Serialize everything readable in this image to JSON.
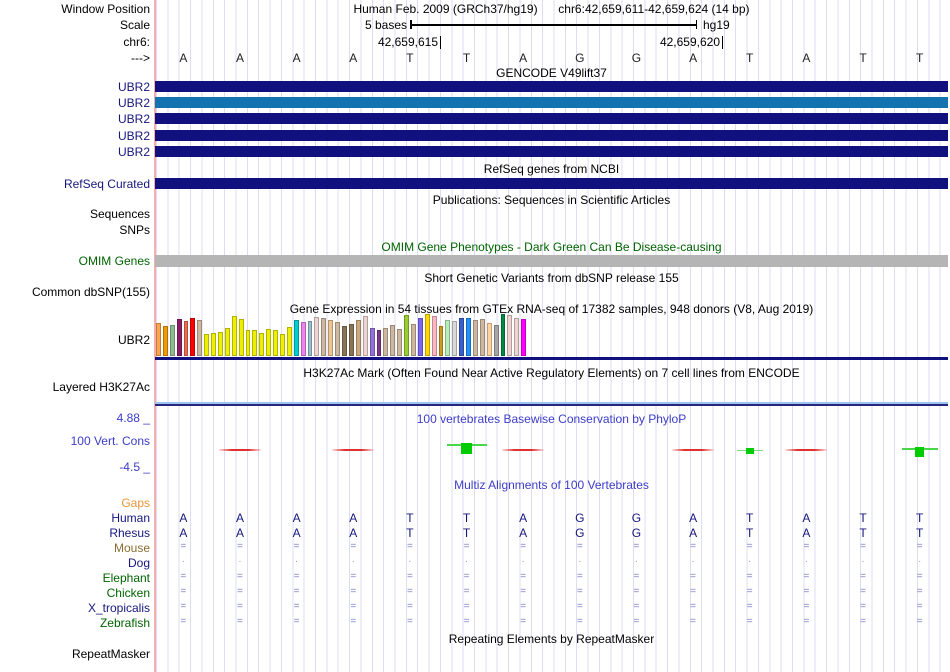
{
  "palette": {
    "navy": "#10107e",
    "steel_blue": "#1273b0",
    "gray_bar": "#b5b5b5",
    "grid_line": "#dcdcf2",
    "window_edge_pink": "#f5afaf",
    "blue_label": "#3c3cc8",
    "green_label": "#006400",
    "orange_label": "#e8953a",
    "align_symbol": "#8181c8",
    "phylop_pos": "#00cc00",
    "phylop_neg": "#e03030",
    "h3k27ac_light": "#9cc3ef",
    "h3k27ac_dark": "#26267e"
  },
  "header": {
    "window_position_label": "Window Position",
    "assembly": "Human Feb. 2009 (GRCh37/hg19)",
    "position": "chr6:42,659,611-42,659,624 (14 bp)",
    "scale_label": "Scale",
    "scale_value": "5 bases",
    "genome": "hg19",
    "chrom_label": "chr6:",
    "tick_left": "42,659,615",
    "tick_right": "42,659,620",
    "strand_arrow": "--->"
  },
  "sequence": {
    "bases": [
      "A",
      "A",
      "A",
      "A",
      "T",
      "T",
      "A",
      "G",
      "G",
      "A",
      "T",
      "A",
      "T",
      "T"
    ]
  },
  "tracks": {
    "gencode": {
      "title": "GENCODE V49lift37",
      "items": [
        {
          "label": "UBR2",
          "color": "#10107e"
        },
        {
          "label": "UBR2",
          "color": "#1273b0"
        },
        {
          "label": "UBR2",
          "color": "#10107e"
        },
        {
          "label": "UBR2",
          "color": "#10107e"
        },
        {
          "label": "UBR2",
          "color": "#10107e"
        }
      ]
    },
    "refseq": {
      "title": "RefSeq genes from NCBI",
      "item_label": "RefSeq Curated",
      "item_color": "#10107e"
    },
    "publications": {
      "title": "Publications: Sequences in Scientific Articles",
      "row_labels": [
        "Sequences",
        "SNPs"
      ]
    },
    "omim": {
      "title": "OMIM Gene Phenotypes - Dark Green Can Be Disease-causing",
      "label": "OMIM Genes",
      "bar_color": "#b5b5b5"
    },
    "dbsnp": {
      "title": "Short Genetic Variants from dbSNP release 155",
      "label": "Common dbSNP(155)"
    },
    "gtex": {
      "title": "Gene Expression in 54 tissues from GTEx RNA-seq of 17382 samples, 948 donors (V8, Aug 2019)",
      "label": "UBR2"
    },
    "h3k27ac": {
      "title": "H3K27Ac Mark (Often Found Near Active Regulatory Elements) on 7 cell lines from ENCODE",
      "label": "Layered H3K27Ac"
    },
    "phylop": {
      "title": "100 vertebrates Basewise Conservation by PhyloP",
      "label": "100 Vert. Cons",
      "scale_max": "4.88 _",
      "scale_min": "-4.5 _",
      "marks": [
        {
          "base": 2,
          "kind": "neg"
        },
        {
          "base": 4,
          "kind": "neg"
        },
        {
          "base": 6,
          "kind": "pos_large"
        },
        {
          "base": 7,
          "kind": "neg"
        },
        {
          "base": 10,
          "kind": "neg"
        },
        {
          "base": 11,
          "kind": "pos_small"
        },
        {
          "base": 12,
          "kind": "neg"
        },
        {
          "base": 14,
          "kind": "pos_medium"
        }
      ]
    },
    "multiz": {
      "title": "Multiz Alignments of 100 Vertebrates",
      "rows": [
        {
          "label": "Gaps",
          "label_color": "#e8953a",
          "content": "empty"
        },
        {
          "label": "Human",
          "label_color": "#16167d",
          "content": "bases"
        },
        {
          "label": "Rhesus",
          "label_color": "#16167d",
          "content": "bases"
        },
        {
          "label": "Mouse",
          "label_color": "#8a6d2f",
          "content": "equals"
        },
        {
          "label": "Dog",
          "label_color": "#16167d",
          "content": "dots"
        },
        {
          "label": "Elephant",
          "label_color": "#006400",
          "content": "equals"
        },
        {
          "label": "Chicken",
          "label_color": "#006400",
          "content": "equals"
        },
        {
          "label": "X_tropicalis",
          "label_color": "#16167d",
          "content": "equals"
        },
        {
          "label": "Zebrafish",
          "label_color": "#006400",
          "content": "equals"
        }
      ],
      "equals_symbol": "=",
      "dot_symbol": "·"
    },
    "repeatmasker": {
      "title": "Repeating Elements by RepeatMasker",
      "label": "RepeatMasker"
    }
  },
  "chart_data": {
    "type": "bar",
    "title": "Gene Expression in 54 tissues from GTEx RNA-seq of 17382 samples, 948 donors (V8, Aug 2019)",
    "gene": "UBR2",
    "n_bars": 54,
    "note": "relative expression bar heights in px (max 42) with GTEx tissue colors, left to right",
    "colors": [
      "#FFA54F",
      "#EE9A00",
      "#8FBC8F",
      "#8B1C62",
      "#EE6A50",
      "#FF0000",
      "#CDB79E",
      "#EEEE00",
      "#EEEE00",
      "#EEEE00",
      "#EEEE00",
      "#EEEE00",
      "#EEEE00",
      "#EEEE00",
      "#EEEE00",
      "#EEEE00",
      "#EEEE00",
      "#EEEE00",
      "#EEEE00",
      "#EEEE00",
      "#00CDCD",
      "#EE82EE",
      "#9AC0CD",
      "#EED5D2",
      "#CDB79E",
      "#EEC591",
      "#CDB79E",
      "#8B7355",
      "#8B7355",
      "#CDAA7D",
      "#EED5D2",
      "#9370DB",
      "#7A378B",
      "#CDB79E",
      "#CDB79E",
      "#CDB79E",
      "#9ACD32",
      "#CDB79E",
      "#7A67EE",
      "#FFD700",
      "#FFB6C1",
      "#CD9B1D",
      "#B4EEB4",
      "#D9D9D9",
      "#3A5FCD",
      "#1E90FF",
      "#CDB79E",
      "#CDB79E",
      "#FFD39B",
      "#A6A6A6",
      "#008B45",
      "#EED5D2",
      "#EED5D2",
      "#FF00FF"
    ],
    "values": [
      33,
      30,
      31,
      37,
      35,
      38,
      36,
      22,
      23,
      24,
      28,
      40,
      37,
      26,
      26,
      23,
      27,
      26,
      22,
      29,
      36,
      34,
      35,
      39,
      38,
      36,
      34,
      30,
      32,
      36,
      40,
      28,
      26,
      28,
      31,
      27,
      41,
      32,
      38,
      42,
      40,
      30,
      36,
      35,
      38,
      38,
      36,
      37,
      33,
      31,
      42,
      41,
      38,
      37
    ]
  }
}
